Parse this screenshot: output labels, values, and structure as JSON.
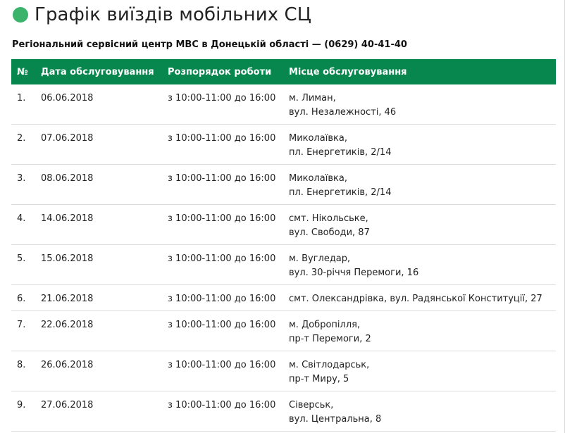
{
  "header": {
    "title": "Графік виїздів мобільних СЦ",
    "subtitle": "Регіональний сервісний центр МВС в Донецькій області — (0629) 40-41-40"
  },
  "colors": {
    "accent": "#07874d",
    "dot": "#3cb36b"
  },
  "table": {
    "columns": [
      "№",
      "Дата обслуговування",
      "Розпорядок роботи",
      "Місце обслуговування"
    ],
    "rows": [
      {
        "num": "1.",
        "date": "06.06.2018",
        "hours": "з 10:00-11:00 до 16:00",
        "place": [
          "м. Лиман,",
          "вул. Незалежності, 46"
        ]
      },
      {
        "num": "2.",
        "date": "07.06.2018",
        "hours": "з 10:00-11:00 до 16:00",
        "place": [
          "Миколаївка,",
          "пл. Енергетиків, 2/14"
        ]
      },
      {
        "num": "3.",
        "date": "08.06.2018",
        "hours": "з 10:00-11:00 до 16:00",
        "place": [
          "Миколаївка,",
          "пл. Енергетиків, 2/14"
        ]
      },
      {
        "num": "4.",
        "date": "14.06.2018",
        "hours": "з 10:00-11:00 до 16:00",
        "place": [
          "смт. Нікольське,",
          "вул. Свободи, 87"
        ]
      },
      {
        "num": "5.",
        "date": "15.06.2018",
        "hours": "з 10:00-11:00 до 16:00",
        "place": [
          "м. Вугледар,",
          "вул. 30-річчя Перемоги, 16"
        ]
      },
      {
        "num": "6.",
        "date": "21.06.2018",
        "hours": "з 10:00-11:00 до 16:00",
        "place": [
          "смт. Олександрівка, вул. Радянської Конституції, 27"
        ]
      },
      {
        "num": "7.",
        "date": "22.06.2018",
        "hours": "з 10:00-11:00 до 16:00",
        "place": [
          "м. Добропілля,",
          "пр-т Перемоги, 2"
        ]
      },
      {
        "num": "8.",
        "date": "26.06.2018",
        "hours": "з 10:00-11:00 до 16:00",
        "place": [
          "м. Світлодарськ,",
          "пр-т Миру, 5"
        ]
      },
      {
        "num": "9.",
        "date": "27.06.2018",
        "hours": "з 10:00-11:00 до 16:00",
        "place": [
          "Сіверськ,",
          "вул. Центральна, 8"
        ]
      }
    ]
  }
}
